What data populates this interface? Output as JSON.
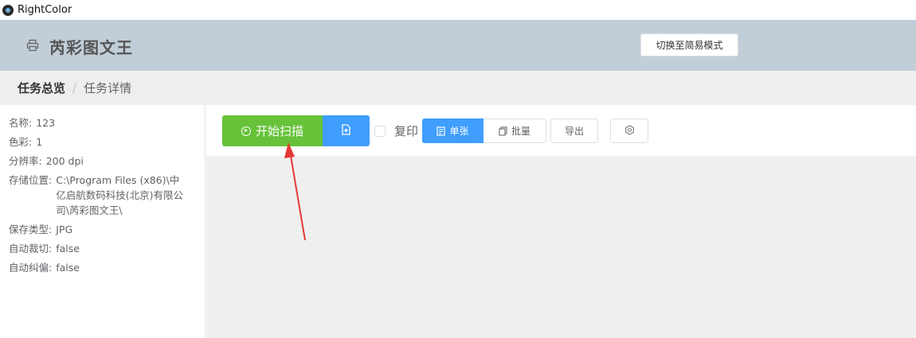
{
  "window": {
    "title": "RightColor"
  },
  "header": {
    "app_name": "芮彩图文王",
    "mode_button": "切换至简易模式"
  },
  "breadcrumb": {
    "items": [
      "任务总览",
      "任务详情"
    ],
    "separator": "/"
  },
  "task_info": {
    "name_label": "名称:",
    "name_value": "123",
    "color_label": "色彩:",
    "color_value": "1",
    "resolution_label": "分辨率:",
    "resolution_value": "200 dpi",
    "storage_label": "存储位置:",
    "storage_value": "C:\\Program Files (x86)\\中亿启航数码科技(北京)有限公司\\芮彩图文王\\",
    "save_type_label": "保存类型:",
    "save_type_value": "JPG",
    "auto_crop_label": "自动裁切:",
    "auto_crop_value": "false",
    "auto_deskew_label": "自动纠偏:",
    "auto_deskew_value": "false"
  },
  "toolbar": {
    "scan_button": "开始扫描",
    "duplex_label": "复印",
    "single_button": "单张",
    "batch_button": "批量",
    "export_button": "导出"
  },
  "icons": {
    "app": "rightcolor-logo-icon",
    "header": "printer-icon",
    "scan": "play-circle-icon",
    "new": "file-add-icon",
    "single": "document-icon",
    "batch": "copy-icon",
    "settings": "gear-icon"
  },
  "colors": {
    "header_bg": "#c1ced8",
    "success": "#67c23a",
    "primary": "#409eff",
    "annotation_arrow": "#e53935"
  }
}
